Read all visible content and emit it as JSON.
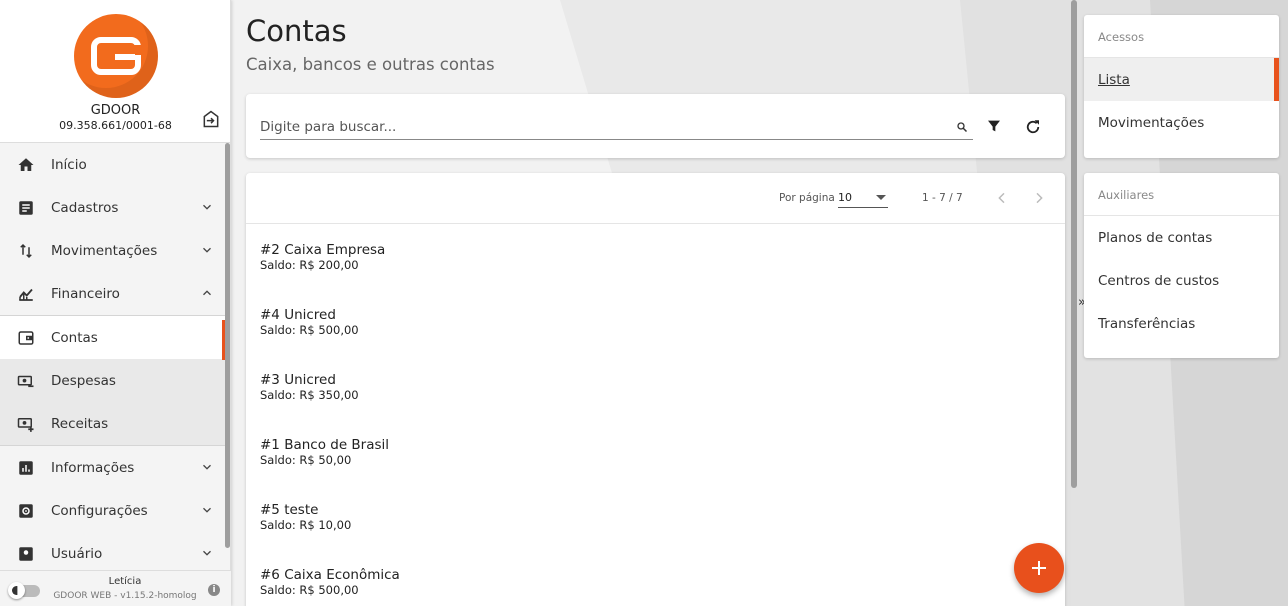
{
  "colors": {
    "accent": "#e8521c",
    "logo": "#f26b1d"
  },
  "brand": {
    "name": "GDOOR",
    "cnpj": "09.358.661/0001-68"
  },
  "menu": {
    "items": [
      {
        "label": "Início",
        "icon": "home-icon"
      },
      {
        "label": "Cadastros",
        "icon": "document-icon"
      },
      {
        "label": "Movimentações",
        "icon": "swap-vertical-icon"
      },
      {
        "label": "Financeiro",
        "icon": "finance-chart-icon"
      }
    ],
    "financeiro_sub": [
      {
        "label": "Contas",
        "icon": "wallet-icon"
      },
      {
        "label": "Despesas",
        "icon": "cash-minus-icon"
      },
      {
        "label": "Receitas",
        "icon": "cash-plus-icon"
      }
    ],
    "items_after": [
      {
        "label": "Informações",
        "icon": "bar-chart-icon"
      },
      {
        "label": "Configurações",
        "icon": "gear-icon"
      },
      {
        "label": "Usuário",
        "icon": "user-icon"
      }
    ]
  },
  "footer": {
    "user": "Letícia",
    "version": "GDOOR WEB - v1.15.2-homolog"
  },
  "page": {
    "title": "Contas",
    "subtitle": "Caixa, bancos e outras contas"
  },
  "search": {
    "placeholder": "Digite para buscar...",
    "value": ""
  },
  "pagination": {
    "per_page_label": "Por página",
    "per_page": "10",
    "range": "1 - 7 / 7"
  },
  "accounts": [
    {
      "name": "#2 Caixa Empresa",
      "balance": "Saldo: R$ 200,00"
    },
    {
      "name": "#4 Unicred",
      "balance": "Saldo: R$ 500,00"
    },
    {
      "name": "#3 Unicred",
      "balance": "Saldo: R$ 350,00"
    },
    {
      "name": "#1 Banco de Brasil",
      "balance": "Saldo: R$ 50,00"
    },
    {
      "name": "#5 teste",
      "balance": "Saldo: R$ 10,00"
    },
    {
      "name": "#6 Caixa Econômica",
      "balance": "Saldo: R$ 500,00"
    }
  ],
  "right_panel": {
    "collapse_label": "»",
    "acessos": {
      "title": "Acessos",
      "items": [
        "Lista",
        "Movimentações"
      ]
    },
    "auxiliares": {
      "title": "Auxiliares",
      "items": [
        "Planos de contas",
        "Centros de custos",
        "Transferências"
      ]
    }
  }
}
